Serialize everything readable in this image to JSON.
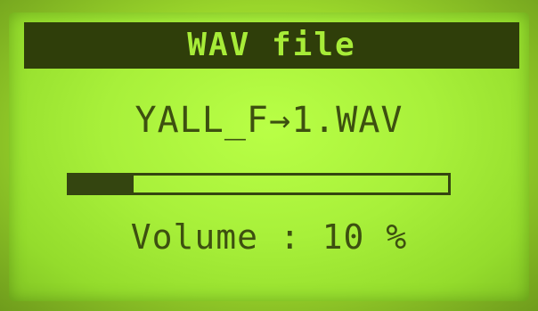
{
  "screen": {
    "title": "WAV file",
    "filename": "YALL_F→1.WAV",
    "progress": 0.17,
    "volume_text": "Volume : 10 %"
  },
  "colors": {
    "lcd_background": "#a8f03a",
    "pixel_dark": "#344510"
  }
}
